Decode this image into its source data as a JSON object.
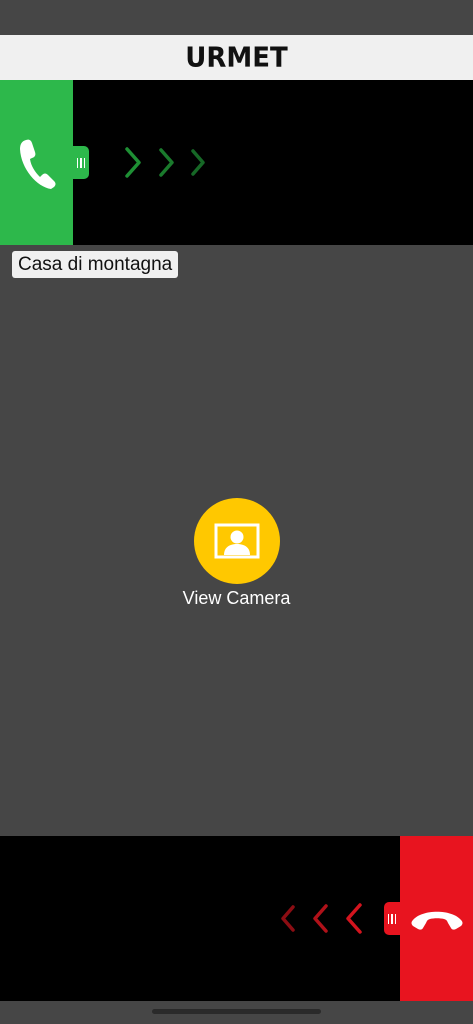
{
  "header": {
    "brand": "URMET"
  },
  "answer": {
    "icon": "phone-answer-icon",
    "color": "#2db84b"
  },
  "decline": {
    "icon": "phone-hangup-icon",
    "color": "#e8141f"
  },
  "site": {
    "name": "Casa di montagna"
  },
  "camera": {
    "label": "View Camera",
    "icon": "portrait-camera-icon",
    "color": "#ffc800"
  }
}
